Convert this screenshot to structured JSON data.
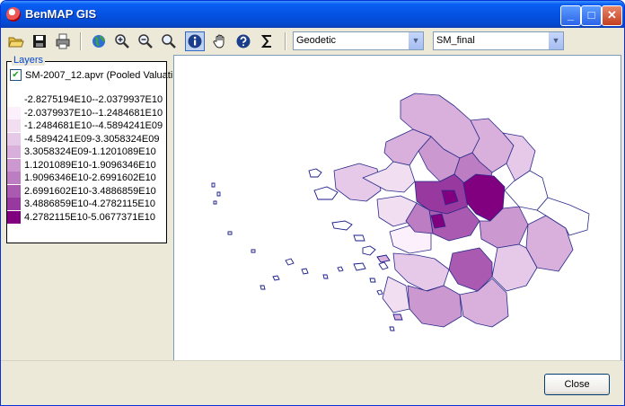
{
  "window": {
    "title": "BenMAP GIS"
  },
  "titlebar_buttons": {
    "minimize": "_",
    "maximize": "□",
    "close": "✕"
  },
  "toolbar": {
    "icons": [
      "open-folder-icon",
      "save-disk-icon",
      "print-icon",
      "globe-icon",
      "zoom-in-icon",
      "zoom-out-icon",
      "zoom-extent-icon",
      "identify-info-icon",
      "pan-hand-icon",
      "query-icon",
      "sigma-icon"
    ],
    "projection_value": "Geodetic",
    "layer_select_value": "SM_final"
  },
  "layers": {
    "group_label": "Layers",
    "layer_name": "SM-2007_12.apvr (Pooled Valuati",
    "checked": true,
    "legend": [
      {
        "label": "-2.8275194E10--2.0379937E10",
        "color": "#ffffff"
      },
      {
        "label": "-2.0379937E10--1.2484681E10",
        "color": "#fbf0fb"
      },
      {
        "label": "-1.2484681E10--4.5894241E09",
        "color": "#f1def1"
      },
      {
        "label": "-4.5894241E09-3.3058324E09",
        "color": "#e6c9e8"
      },
      {
        "label": "3.3058324E09-1.1201089E10",
        "color": "#d9b0dc"
      },
      {
        "label": "1.1201089E10-1.9096346E10",
        "color": "#cc98d0"
      },
      {
        "label": "1.9096346E10-2.6991602E10",
        "color": "#bc7dc2"
      },
      {
        "label": "2.6991602E10-3.4886859E10",
        "color": "#aa5bb1"
      },
      {
        "label": "3.4886859E10-4.2782115E10",
        "color": "#97399f"
      },
      {
        "label": "4.2782115E10-5.0677371E10",
        "color": "#800080"
      }
    ]
  },
  "buttons": {
    "close": "Close"
  }
}
